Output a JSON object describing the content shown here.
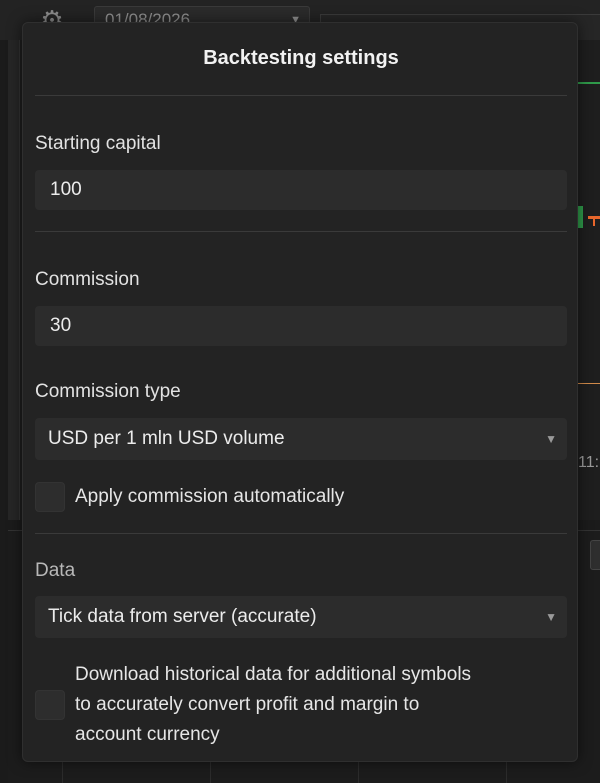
{
  "background": {
    "date_value": "01/08/2026",
    "time_label": "11:"
  },
  "popup": {
    "title": "Backtesting settings",
    "starting_capital": {
      "label": "Starting capital",
      "value": "100"
    },
    "commission": {
      "label": "Commission",
      "value": "30"
    },
    "commission_type": {
      "label": "Commission type",
      "selected": "USD per 1 mln USD volume"
    },
    "apply_commission": {
      "label": "Apply commission automatically",
      "checked": false
    },
    "data": {
      "label": "Data",
      "selected": "Tick data from server (accurate)"
    },
    "download_historical": {
      "line1": "Download historical data for additional symbols",
      "line2": "to accurately convert profit and margin to",
      "line3": "account currency",
      "checked": false
    }
  },
  "colors": {
    "popup_bg": "#232323",
    "input_bg": "#2c2c2c",
    "accent_green": "#2f9a4a",
    "accent_orange": "#e8672c"
  }
}
